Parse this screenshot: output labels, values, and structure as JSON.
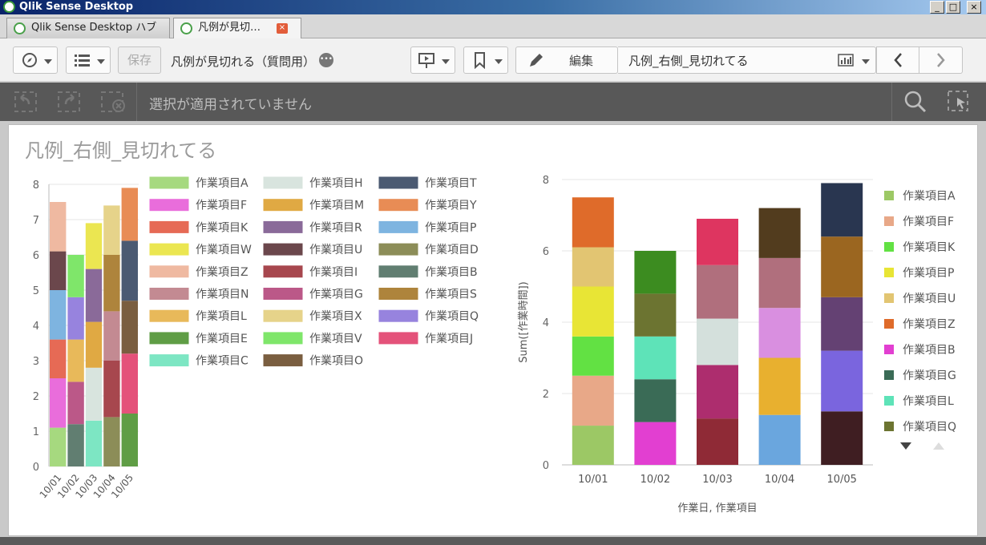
{
  "window": {
    "title": "Qlik Sense Desktop"
  },
  "tabs": [
    {
      "label": "Qlik Sense Desktop ハブ"
    },
    {
      "label": "凡例が見切…",
      "close": "×"
    }
  ],
  "toolbar": {
    "save_label": "保存",
    "app_title": "凡例が見切れる（質問用）",
    "edit_label": "編集",
    "current_sheet": "凡例_右側_見切れてる"
  },
  "selections": {
    "empty_text": "選択が適用されていません"
  },
  "sheet": {
    "title": "凡例_右側_見切れてる"
  },
  "colors": {
    "作業項目A": "#a6d97f",
    "作業項目H": "#d8e4de",
    "作業項目T": "#4b5a72",
    "作業項目F": "#e96ddb",
    "作業項目M": "#e0a943",
    "作業項目Y": "#e88c55",
    "作業項目K": "#e66a55",
    "作業項目R": "#8a6a99",
    "作業項目P": "#7eb4e0",
    "作業項目W": "#ebe651",
    "作業項目U": "#6b474c",
    "作業項目D": "#8c8d58",
    "作業項目Z": "#efb9a1",
    "作業項目I": "#a7474e",
    "作業項目B": "#617e71",
    "作業項目N": "#c38a92",
    "作業項目G": "#bb5888",
    "作業項目S": "#ae843c",
    "作業項目L": "#e8b95a",
    "作業項目X": "#e6d38a",
    "作業項目Q": "#9783de",
    "作業項目E": "#5f9d45",
    "作業項目V": "#7fe66a",
    "作業項目J": "#e4527a",
    "作業項目C": "#7de6c3",
    "作業項目O": "#7a5e40"
  },
  "colors_right": {
    "作業項目A": "#9cc865",
    "作業項目F": "#e8a888",
    "作業項目K": "#62e143",
    "作業項目P": "#e8e535",
    "作業項目U": "#e2c572",
    "作業項目Z": "#df6b2a",
    "作業項目B": "#e23fd1",
    "作業項目G": "#3a6b56",
    "作業項目L": "#5ee3b8",
    "作業項目Q": "#6c7431",
    "作業項目I": "#8f2a36",
    "作業項目C": "#d4e0dc",
    "作業項目N": "#ad2d6e",
    "作業項目V": "#de3560",
    "作業項目M": "#e8b02f",
    "作業項目D": "#d98fe0",
    "作業項目E": "#b06f7d",
    "作業項目J": "#523c1e",
    "作業項目S": "#3f1e22",
    "作業項目R": "#7a65de",
    "作業項目O": "#644173",
    "作業項目Y": "#9b6620",
    "作業項目T": "#293650",
    "作業項目W": "#6aa6de",
    "作業項目H": "#3c8c20"
  },
  "chart_data": [
    {
      "type": "bar",
      "stacked": true,
      "categories": [
        "10/01",
        "10/02",
        "10/03",
        "10/04",
        "10/05"
      ],
      "ylim": [
        0,
        8
      ],
      "yticks": [
        "0",
        "1",
        "2",
        "3",
        "4",
        "5",
        "6",
        "7",
        "8"
      ],
      "legend_position": "right",
      "legend": [
        "作業項目A",
        "作業項目H",
        "作業項目T",
        "作業項目F",
        "作業項目M",
        "作業項目Y",
        "作業項目K",
        "作業項目R",
        "作業項目P",
        "作業項目W",
        "作業項目U",
        "作業項目D",
        "作業項目Z",
        "作業項目I",
        "作業項目B",
        "作業項目N",
        "作業項目G",
        "作業項目S",
        "作業項目L",
        "作業項目X",
        "作業項目Q",
        "作業項目E",
        "作業項目V",
        "作業項目J",
        "作業項目C",
        "作業項目O"
      ],
      "stacks": [
        [
          [
            "作業項目A",
            1.1
          ],
          [
            "作業項目F",
            1.4
          ],
          [
            "作業項目K",
            1.1
          ],
          [
            "作業項目P",
            1.4
          ],
          [
            "作業項目U",
            1.1
          ],
          [
            "作業項目Z",
            1.4
          ]
        ],
        [
          [
            "作業項目B",
            1.2
          ],
          [
            "作業項目G",
            1.2
          ],
          [
            "作業項目L",
            1.2
          ],
          [
            "作業項目Q",
            1.2
          ],
          [
            "作業項目V",
            1.2
          ]
        ],
        [
          [
            "作業項目C",
            1.3
          ],
          [
            "作業項目H",
            1.5
          ],
          [
            "作業項目M",
            1.3
          ],
          [
            "作業項目R",
            1.5
          ],
          [
            "作業項目W",
            1.3
          ]
        ],
        [
          [
            "作業項目D",
            1.4
          ],
          [
            "作業項目I",
            1.6
          ],
          [
            "作業項目N",
            1.4
          ],
          [
            "作業項目S",
            1.6
          ],
          [
            "作業項目X",
            1.4
          ]
        ],
        [
          [
            "作業項目E",
            1.5
          ],
          [
            "作業項目J",
            1.7
          ],
          [
            "作業項目O",
            1.5
          ],
          [
            "作業項目T",
            1.7
          ],
          [
            "作業項目Y",
            1.5
          ]
        ]
      ]
    },
    {
      "type": "bar",
      "stacked": true,
      "categories": [
        "10/01",
        "10/02",
        "10/03",
        "10/04",
        "10/05"
      ],
      "ylim": [
        0,
        8
      ],
      "yticks": [
        "0",
        "2",
        "4",
        "6",
        "8"
      ],
      "ylabel": "Sum([作業時間])",
      "xlabel": "作業日, 作業項目",
      "legend_position": "right",
      "legend": [
        "作業項目A",
        "作業項目F",
        "作業項目K",
        "作業項目P",
        "作業項目U",
        "作業項目Z",
        "作業項目B",
        "作業項目G",
        "作業項目L",
        "作業項目Q"
      ],
      "stacks": [
        [
          [
            "作業項目A",
            1.1
          ],
          [
            "作業項目F",
            1.4
          ],
          [
            "作業項目K",
            1.1
          ],
          [
            "作業項目P",
            1.4
          ],
          [
            "作業項目U",
            1.1
          ],
          [
            "作業項目Z",
            1.4
          ]
        ],
        [
          [
            "作業項目B",
            1.2
          ],
          [
            "作業項目G",
            1.2
          ],
          [
            "作業項目L",
            1.2
          ],
          [
            "作業項目Q",
            1.2
          ],
          [
            "作業項目H",
            1.2
          ]
        ],
        [
          [
            "作業項目I",
            1.3
          ],
          [
            "作業項目N",
            1.5
          ],
          [
            "作業項目C",
            1.3
          ],
          [
            "作業項目E",
            1.5
          ],
          [
            "作業項目V",
            1.3
          ]
        ],
        [
          [
            "作業項目W",
            1.4
          ],
          [
            "作業項目M",
            1.6
          ],
          [
            "作業項目D",
            1.4
          ],
          [
            "作業項目E",
            1.4
          ],
          [
            "作業項目J",
            1.4
          ]
        ],
        [
          [
            "作業項目S",
            1.5
          ],
          [
            "作業項目R",
            1.7
          ],
          [
            "作業項目O",
            1.5
          ],
          [
            "作業項目Y",
            1.7
          ],
          [
            "作業項目T",
            1.5
          ]
        ]
      ]
    }
  ]
}
